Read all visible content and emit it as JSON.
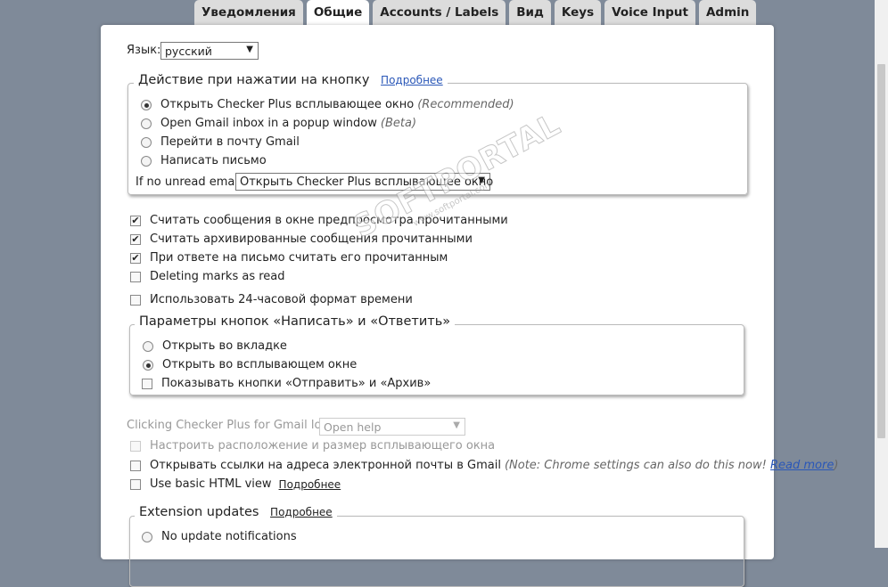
{
  "tabs": [
    {
      "label": "Уведомления",
      "active": false
    },
    {
      "label": "Общие",
      "active": true
    },
    {
      "label": "Accounts / Labels",
      "active": false
    },
    {
      "label": "Вид",
      "active": false
    },
    {
      "label": "Keys",
      "active": false
    },
    {
      "label": "Voice Input",
      "active": false
    },
    {
      "label": "Admin",
      "active": false
    }
  ],
  "language": {
    "label": "Язык:",
    "value": "русский"
  },
  "button_action": {
    "title": "Действие при нажатии на кнопку",
    "more": "Подробнее",
    "options": [
      {
        "label": "Открыть Checker Plus всплывающее окно",
        "hint": "(Recommended)",
        "selected": true
      },
      {
        "label": "Open Gmail inbox in a popup window",
        "hint": "(Beta)",
        "selected": false
      },
      {
        "label": "Перейти в почту Gmail",
        "hint": "",
        "selected": false
      },
      {
        "label": "Написать письмо",
        "hint": "",
        "selected": false
      }
    ],
    "no_unread_label": "If no unread email:",
    "no_unread_value": "Открыть Checker Plus всплывающее окно"
  },
  "checkboxes": [
    {
      "label": "Считать сообщения в окне предпросмотра прочитанными",
      "checked": true
    },
    {
      "label": "Считать архивированные сообщения прочитанными",
      "checked": true
    },
    {
      "label": "При ответе на письмо считать его прочитанным",
      "checked": true
    },
    {
      "label": "Deleting marks as read",
      "checked": false
    },
    {
      "label": "Использовать 24-часовой формат времени",
      "checked": false
    }
  ],
  "compose_params": {
    "title": "Параметры кнопок «Написать» и «Ответить»",
    "options": [
      {
        "label": "Открыть во вкладке",
        "selected": false
      },
      {
        "label": "Открыть во всплывающем окне",
        "selected": true
      }
    ],
    "show_buttons": {
      "label": "Показывать кнопки «Отправить» и «Архив»",
      "checked": false
    }
  },
  "logo_click": {
    "label": "Clicking Checker Plus for Gmail logo:",
    "value": "Open help"
  },
  "popup_position": {
    "label": "Настроить расположение и размер всплывающего окна",
    "checked": false
  },
  "mailto": {
    "label": "Открывать ссылки на адреса электронной почты в Gmail",
    "note": "(Note: Chrome settings can also do this now!",
    "link": "Read more",
    "note_end": ")",
    "checked": false
  },
  "basic_html": {
    "label": "Use basic HTML view",
    "more": "Подробнее",
    "checked": false
  },
  "extension_updates": {
    "title": "Extension updates",
    "more": "Подробнее",
    "option": "No update notifications"
  },
  "watermark": {
    "big": "SOFTPORTAL",
    "small": "www.softportal.com"
  },
  "colors": {
    "background": "#7f8a99",
    "link": "#2a57b8"
  }
}
